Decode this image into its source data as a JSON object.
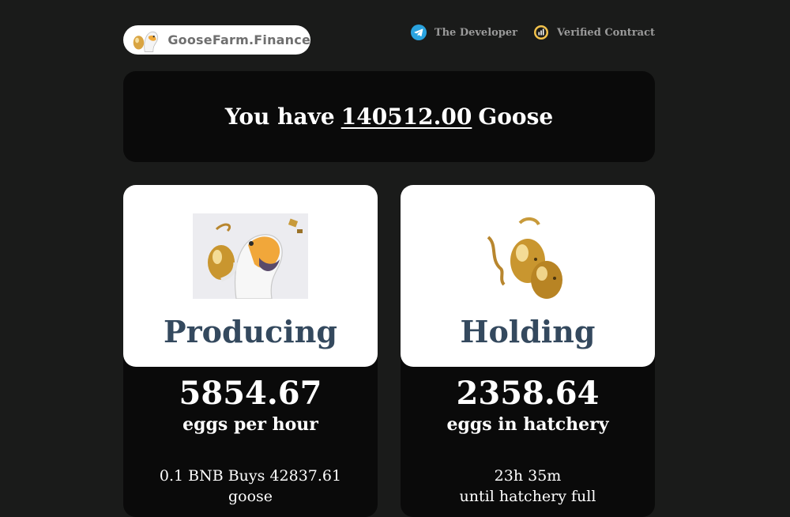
{
  "header": {
    "logo_text": "GooseFarm.Finance",
    "nav": [
      {
        "label": "The Developer",
        "icon": "telegram-icon"
      },
      {
        "label": "Verified Contract",
        "icon": "verified-contract-icon"
      }
    ]
  },
  "balance": {
    "prefix": "You have",
    "amount": "140512.00",
    "suffix": "Goose"
  },
  "cards": [
    {
      "title": "Producing",
      "value": "5854.67",
      "unit": "eggs per hour",
      "info_line1": "0.1 BNB Buys 42837.61",
      "info_line2": "goose"
    },
    {
      "title": "Holding",
      "value": "2358.64",
      "unit": "eggs in hatchery",
      "info_line1": "23h 35m",
      "info_line2": "until hatchery full"
    }
  ],
  "colors": {
    "background": "#1a1b1a",
    "panel": "#0a0a0a",
    "card_title": "#34495e",
    "telegram": "#2aa3df",
    "gold": "#c8a24a"
  }
}
